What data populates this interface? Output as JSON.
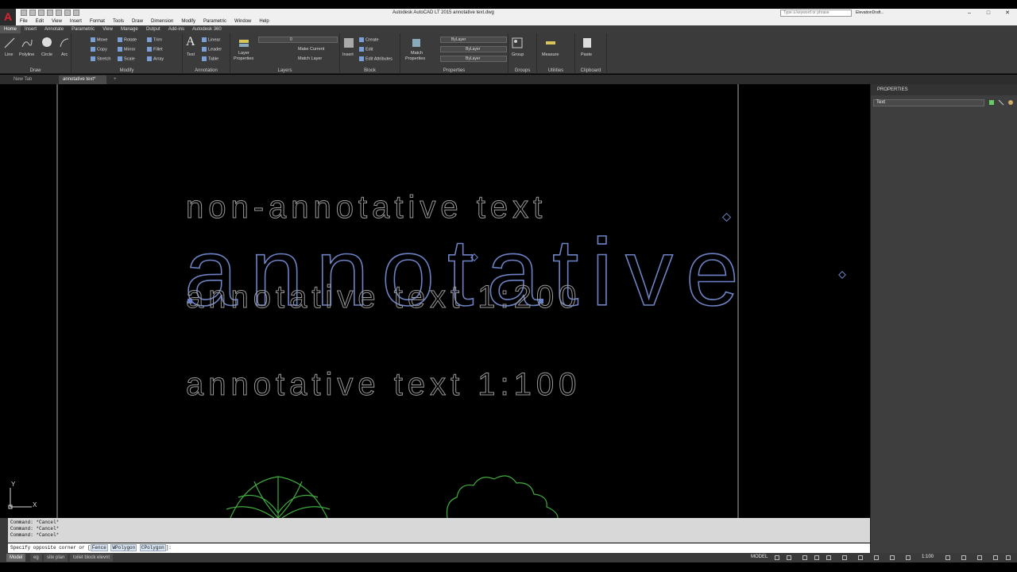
{
  "app": {
    "title": "Autodesk AutoCAD LT 2015    annotative text.dwg",
    "search_placeholder": "Type a keyword or phrase",
    "user": "ElevationDraft..."
  },
  "menu": [
    "File",
    "Edit",
    "View",
    "Insert",
    "Format",
    "Tools",
    "Draw",
    "Dimension",
    "Modify",
    "Parametric",
    "Window",
    "Help"
  ],
  "ribbon_tabs": [
    "Home",
    "Insert",
    "Annotate",
    "Parametric",
    "View",
    "Manage",
    "Output",
    "Add-ins",
    "Autodesk 360"
  ],
  "ribbon": {
    "draw": {
      "label": "Draw",
      "line": "Line",
      "polyline": "Polyline",
      "circle": "Circle",
      "arc": "Arc"
    },
    "modify": {
      "label": "Modify",
      "move": "Move",
      "rotate": "Rotate",
      "trim": "Trim",
      "copy": "Copy",
      "mirror": "Mirror",
      "fillet": "Fillet",
      "stretch": "Stretch",
      "scale": "Scale",
      "array": "Array"
    },
    "annotation": {
      "label": "Annotation",
      "text": "Text",
      "linear": "Linear",
      "leader": "Leader",
      "table": "Table"
    },
    "layers": {
      "label": "Layers",
      "layer_properties_1": "Layer",
      "layer_properties_2": "Properties",
      "layer_value": "0",
      "make_current": "Make Current",
      "match_layer": "Match Layer"
    },
    "block": {
      "label": "Block",
      "insert": "Insert",
      "create": "Create",
      "edit": "Edit",
      "edit_attributes": "Edit Attributes"
    },
    "properties": {
      "label": "Properties",
      "match_1": "Match",
      "match_2": "Properties",
      "color": "ByLayer",
      "linetype": "ByLayer",
      "lineweight": "ByLayer"
    },
    "groups": {
      "label": "Groups",
      "group": "Group"
    },
    "utilities": {
      "label": "Utilities",
      "measure": "Measure"
    },
    "clipboard": {
      "label": "Clipboard",
      "paste": "Paste"
    }
  },
  "doc_tabs": {
    "new_tab": "New Tab",
    "active": "annotative text*"
  },
  "drawing": {
    "text_non_annotative": "non-annotative text",
    "text_annotative_big": "annotative",
    "text_annotative_200": "annotative text 1:200",
    "text_annotative_100": "annotative text 1:100",
    "ucs_y": "Y",
    "ucs_x": "X"
  },
  "properties_panel": {
    "header": "PROPERTIES",
    "selection": "Text"
  },
  "command": {
    "history": [
      "Command: *Cancel*",
      "Command: *Cancel*",
      "Command: *Cancel*"
    ],
    "prompt": "Specify opposite corner or [",
    "opt1": "Fence",
    "opt2": "WPolygon",
    "opt3": "CPolygon",
    "prompt_end": "]:"
  },
  "status": {
    "layout_tabs": [
      "Model",
      "eg",
      "site plan",
      "toilet block elevnt"
    ],
    "model": "MODEL",
    "scale": "1:100"
  }
}
